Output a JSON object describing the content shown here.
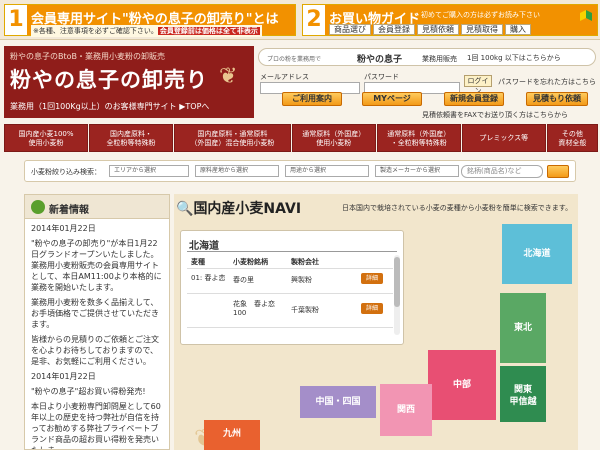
{
  "topbar": {
    "box1": {
      "num": "1",
      "title": "会員専用サイト\"粉やの息子の卸売り\"とは",
      "note_prefix": "※各種、注意事項を必ずご確認下さい。",
      "note_highlight": "会員登録前は価格は全て非表示"
    },
    "box2": {
      "num": "2",
      "title": "お買い物ガイド",
      "hint": "初めてご購入の方は必ずお読み下さい",
      "links": [
        "商品選び",
        "会員登録",
        "見積依頼",
        "見積取得",
        "購入"
      ]
    }
  },
  "logo": {
    "tagline": "粉やの息子のBtoB・業務用小麦粉の卸販売",
    "name": "粉やの息子の卸売り",
    "sub": "業務用（1回100Kg以上）のお客様専門サイト",
    "top_link": "▶TOPへ"
  },
  "userbar": {
    "pill_small": "プロの粉を業務用で",
    "pill_brand": "粉やの息子",
    "pill_sub": "業務用販売",
    "pill_min": "1回 100kg 以下はこちらから",
    "email_label": "メールアドレス",
    "password_label": "パスワード",
    "login": "ログイン",
    "forgot": "パスワードを忘れた方はこちら",
    "buttons": [
      "ご利用案内",
      "MYページ",
      "新規会員登録",
      "見積もり依頼"
    ],
    "fax": "見積依頼書をFAXでお送り頂く方はこちらから"
  },
  "rednav": [
    [
      "国内産小麦100%",
      "使用小麦粉"
    ],
    [
      "国内産原料・",
      "全粒粉等特殊粉"
    ],
    [
      "国内産原料・通常原料",
      "（外国産）混合使用小麦粉"
    ],
    [
      "通常原料（外国産）",
      "使用小麦粉"
    ],
    [
      "通常原料（外国産）",
      "・全粒粉等特殊粉"
    ],
    [
      "プレミックス等",
      ""
    ],
    [
      "その他",
      "資材全般"
    ]
  ],
  "filter": {
    "label": "小麦粉絞り込み検索：",
    "selects": [
      "エリアから選択",
      "原料産地から選択",
      "用途から選択",
      "製造メーカーから選択"
    ],
    "search_placeholder": "銘柄(商品名)など"
  },
  "news": {
    "title": "新着情報",
    "paragraphs": [
      "2014年01月22日",
      "\"粉やの息子の卸売り\"が本日1月22日グランドオープンいたしました。業務用小麦粉販売の会員専用サイトとして、本日AM11:00より本格的に業務を開始いたします。",
      "業務用小麦粉を数多く品揃えして、お手頃価格でご提供させていただきます。",
      "皆様からの見積りのご依頼とご注文を心よりお待ちしておりますので、是非、お気軽にご利用ください。",
      "2014年01月22日",
      "\"粉やの息子\"超お買い得粉発売!",
      "本日より小麦粉専門卸問屋として60年以上の歴史を持つ弊社が自信を持ってお勧めする弊社プライベートブランド商品の超お買い得粉を発売いたしま"
    ]
  },
  "main": {
    "title": "国内産小麦NAVI",
    "subtitle": "日本国内で栽培されている小麦の麦種から小麦粉を簡単に検索できます。",
    "list": {
      "region": "北海道",
      "headers": [
        "麦種",
        "小麦粉銘柄",
        "製粉会社"
      ],
      "rows": [
        {
          "variety": "01: 春よ恋",
          "brand": "春の里",
          "mill": "興製粉",
          "detail": "詳細"
        },
        {
          "variety": "",
          "brand": "花象　春よ恋 100",
          "mill": "千葉製粉",
          "detail": "詳細"
        }
      ]
    },
    "regions": {
      "hokkaido": "北海道",
      "tohoku": "東北",
      "kanto": "関東\n甲信越",
      "chubu": "中部",
      "kansai": "関西",
      "chugoku": "中国・四国",
      "kyushu": "九州"
    },
    "colors": {
      "hokkaido": "#5dbfd8",
      "tohoku": "#5aa864",
      "kanto": "#2f8c50",
      "chubu": "#e84f73",
      "kansai": "#f295b3",
      "chugoku": "#a48ec9",
      "kyushu": "#e9612f"
    }
  }
}
